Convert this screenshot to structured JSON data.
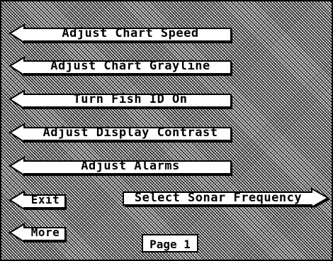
{
  "menu": {
    "items": [
      {
        "label": "Adjust Chart Speed"
      },
      {
        "label": "Adjust Chart Grayline"
      },
      {
        "label": "Turn Fish ID On"
      },
      {
        "label": "Adjust Display Contrast"
      },
      {
        "label": "Adjust Alarms"
      }
    ],
    "exit_label": "Exit",
    "more_label": "More",
    "sonar_frequency_label": "Select Sonar Frequency"
  },
  "page": {
    "label": "Page 1"
  },
  "icons": {
    "left_arrow": "left-arrow-icon",
    "right_arrow": "right-arrow-icon"
  },
  "colors": {
    "background": "#9a9a9a",
    "button_fill": "#ffffff",
    "outline": "#000000"
  }
}
